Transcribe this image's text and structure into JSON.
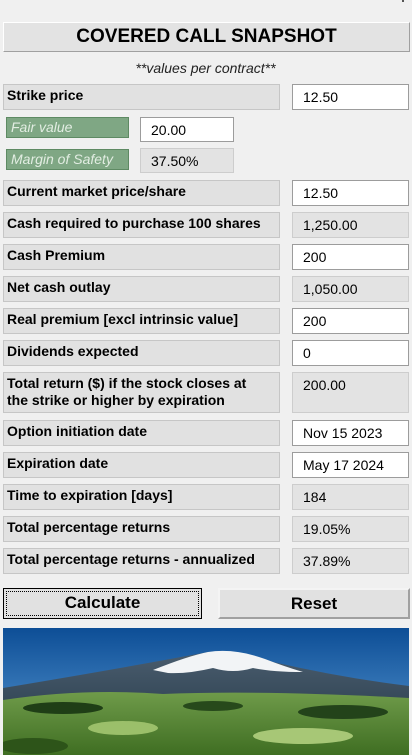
{
  "title": "COVERED CALL SNAPSHOT",
  "subtitle": "**values per contract**",
  "strike_price": {
    "label": "Strike price",
    "value": "12.50"
  },
  "fair_value": {
    "label": "Fair value",
    "value": "20.00"
  },
  "margin_of_safety": {
    "label": "Margin of Safety",
    "value": "37.50%"
  },
  "current_price": {
    "label": "Current market price/share",
    "value": "12.50"
  },
  "cash_required": {
    "label": "Cash required to purchase 100 shares",
    "value": "1,250.00"
  },
  "cash_premium": {
    "label": "Cash Premium",
    "value": "200"
  },
  "net_cash_outlay": {
    "label": "Net cash outlay",
    "value": "1,050.00"
  },
  "real_premium": {
    "label": "Real premium [excl intrinsic value]",
    "value": "200"
  },
  "dividends": {
    "label": "Dividends expected",
    "value": "0"
  },
  "total_return": {
    "label_line1": "Total return ($) if the stock closes at",
    "label_line2": "the strike or higher by expiration",
    "value": "200.00"
  },
  "initiation_date": {
    "label": "Option initiation date",
    "value": "Nov 15 2023"
  },
  "expiration_date": {
    "label": "Expiration date",
    "value": "May 17 2024"
  },
  "time_to_expiration": {
    "label": "Time to expiration [days]",
    "value": "184"
  },
  "total_pct_return": {
    "label": "Total percentage returns",
    "value": "19.05%"
  },
  "annualized_return": {
    "label": "Total percentage returns - annualized",
    "value": "37.89%"
  },
  "buttons": {
    "calculate": "Calculate",
    "reset": "Reset"
  },
  "colors": {
    "accent_green": "#7fa784"
  }
}
